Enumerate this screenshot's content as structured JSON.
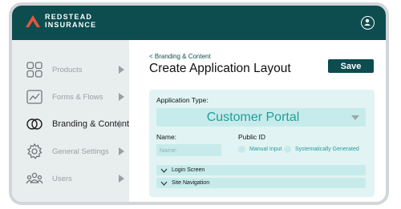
{
  "brand": {
    "line1": "REDSTEAD",
    "line2": "INSURANCE",
    "accent": "#e8553d",
    "primary": "#0d4c4f"
  },
  "header": {
    "avatar_icon": "user-circle-icon"
  },
  "sidebar": {
    "items": [
      {
        "label": "Products",
        "icon": "grid-squares-icon",
        "active": false
      },
      {
        "label": "Forms & Flows",
        "icon": "line-chart-icon",
        "active": false
      },
      {
        "label": "Branding & Content",
        "icon": "overlapping-circles-icon",
        "active": true
      },
      {
        "label": "General Settings",
        "icon": "gear-icon",
        "active": false
      },
      {
        "label": "Users",
        "icon": "users-icon",
        "active": false
      }
    ]
  },
  "main": {
    "breadcrumb": "< Branding & Content",
    "title": "Create Application Layout",
    "save_label": "Save",
    "form": {
      "app_type_label": "Application Type:",
      "app_type_value": "Customer Portal",
      "name_label": "Name:",
      "name_placeholder": "Name:",
      "public_id_label": "Public ID",
      "radio_options": [
        "Manual Input",
        "Systematically Generated"
      ],
      "sections": [
        "Login Screen",
        "Site Navigation"
      ]
    }
  }
}
